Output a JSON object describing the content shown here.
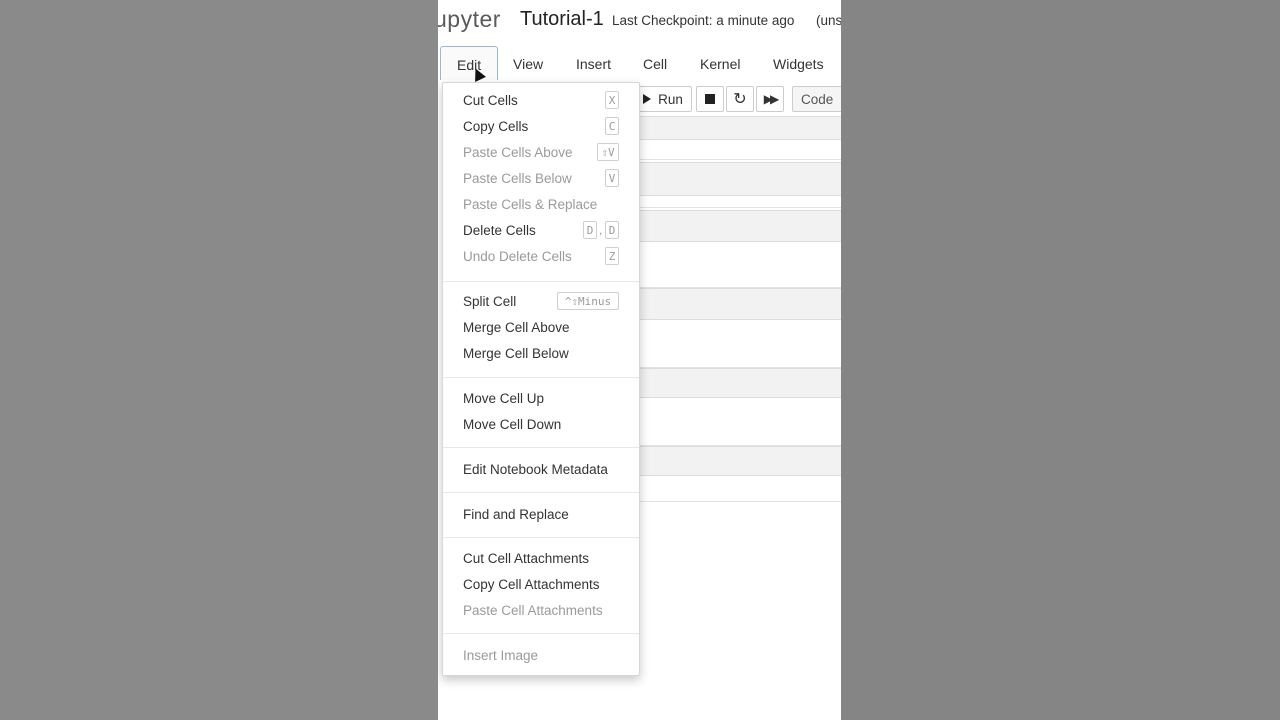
{
  "header": {
    "logo_text": "upyter",
    "notebook_title": "Tutorial-1",
    "checkpoint": "Last Checkpoint: a minute ago",
    "save_status": "(uns"
  },
  "menubar": {
    "items": [
      {
        "label": "Edit"
      },
      {
        "label": "View"
      },
      {
        "label": "Insert"
      },
      {
        "label": "Cell"
      },
      {
        "label": "Kernel"
      },
      {
        "label": "Widgets"
      }
    ]
  },
  "toolbar": {
    "run_label": "Run",
    "cell_type": "Code"
  },
  "edit_menu": {
    "items": [
      {
        "label": "Cut Cells",
        "shortcut": "X",
        "enabled": true
      },
      {
        "label": "Copy Cells",
        "shortcut": "C",
        "enabled": true
      },
      {
        "label": "Paste Cells Above",
        "shortcut": "⇧V",
        "enabled": false
      },
      {
        "label": "Paste Cells Below",
        "shortcut": "V",
        "enabled": false
      },
      {
        "label": "Paste Cells & Replace",
        "shortcut": "",
        "enabled": false
      },
      {
        "label": "Delete Cells",
        "shortcut_a": "D",
        "shortcut_sep": ",",
        "shortcut_b": "D",
        "enabled": true
      },
      {
        "label": "Undo Delete Cells",
        "shortcut": "Z",
        "enabled": false
      },
      {
        "label": "Split Cell",
        "shortcut": "^⇧Minus",
        "enabled": true
      },
      {
        "label": "Merge Cell Above",
        "enabled": true
      },
      {
        "label": "Merge Cell Below",
        "enabled": true
      },
      {
        "label": "Move Cell Up",
        "enabled": true
      },
      {
        "label": "Move Cell Down",
        "enabled": true
      },
      {
        "label": "Edit Notebook Metadata",
        "enabled": true
      },
      {
        "label": "Find and Replace",
        "enabled": true
      },
      {
        "label": "Cut Cell Attachments",
        "enabled": true
      },
      {
        "label": "Copy Cell Attachments",
        "enabled": true
      },
      {
        "label": "Paste Cell Attachments",
        "enabled": false
      },
      {
        "label": "Insert Image",
        "enabled": false
      }
    ]
  }
}
